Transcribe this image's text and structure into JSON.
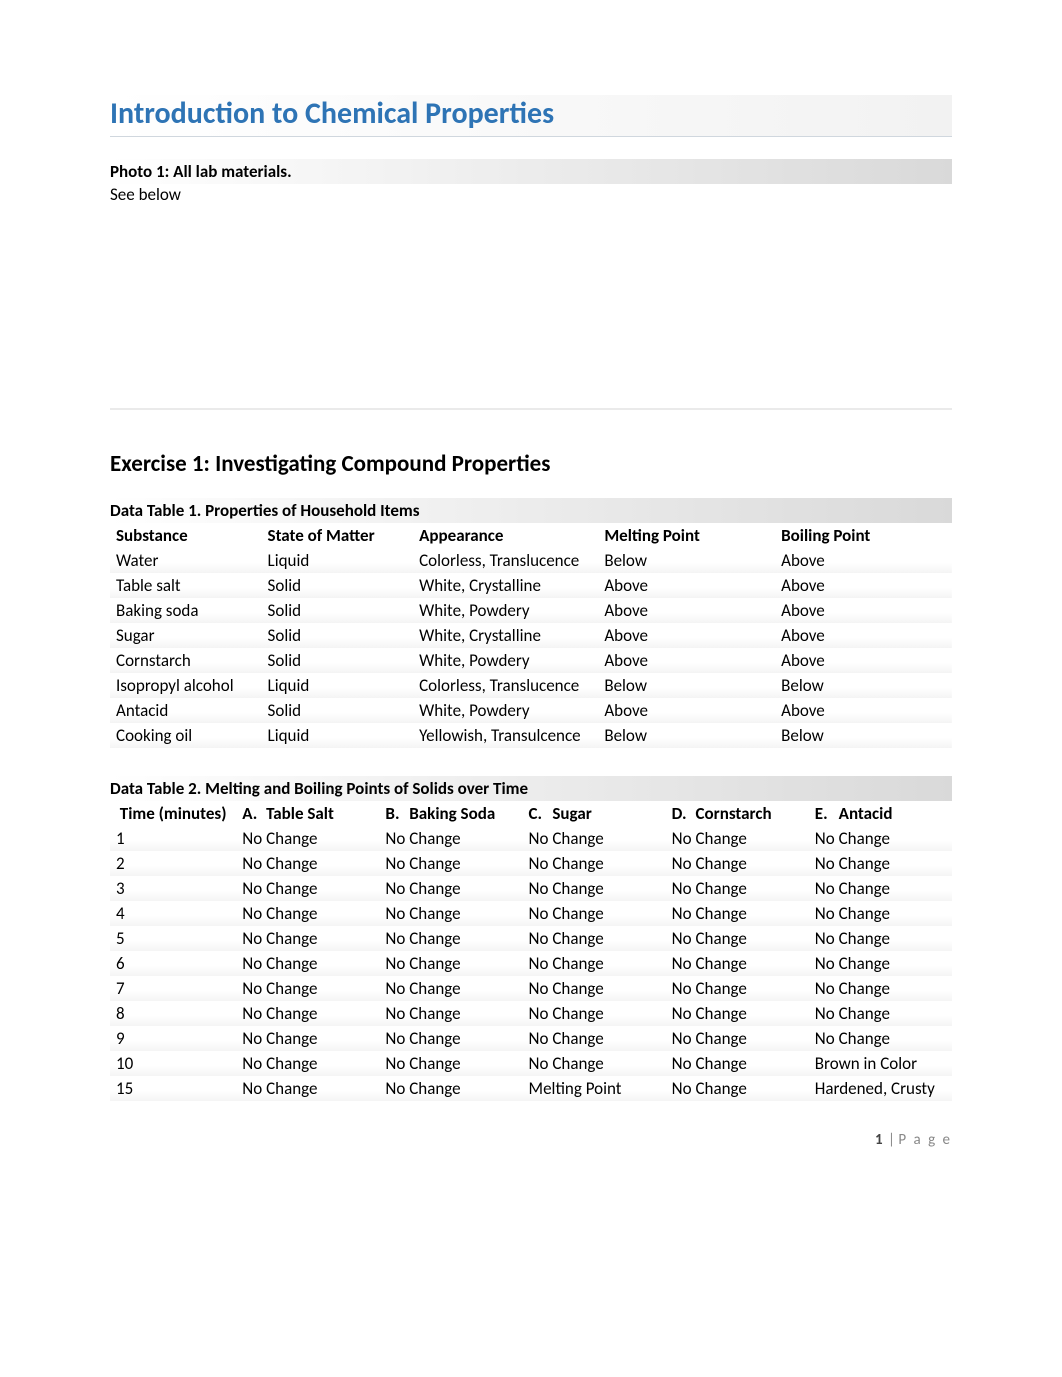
{
  "title": "Introduction to Chemical Properties",
  "photo": {
    "caption": "Photo 1: All lab materials.",
    "note": "See below"
  },
  "exercise1": {
    "title": "Exercise 1: Investigating Compound Properties",
    "table1": {
      "title": "Data Table 1. Properties of Household Items",
      "headers": [
        "Substance",
        "State of Matter",
        "Appearance",
        "Melting Point",
        "Boiling Point"
      ],
      "rows": [
        [
          "Water",
          "Liquid",
          "Colorless, Translucence",
          "Below",
          "Above"
        ],
        [
          "Table salt",
          "Solid",
          "White, Crystalline",
          "Above",
          "Above"
        ],
        [
          "Baking soda",
          "Solid",
          "White, Powdery",
          "Above",
          "Above"
        ],
        [
          "Sugar",
          "Solid",
          "White, Crystalline",
          "Above",
          "Above"
        ],
        [
          "Cornstarch",
          "Solid",
          "White, Powdery",
          "Above",
          "Above"
        ],
        [
          "Isopropyl alcohol",
          "Liquid",
          "Colorless, Translucence",
          "Below",
          "Below"
        ],
        [
          "Antacid",
          "Solid",
          "White, Powdery",
          "Above",
          "Above"
        ],
        [
          "Cooking oil",
          "Liquid",
          "Yellowish, Transulcence",
          "Below",
          "Below"
        ]
      ]
    },
    "table2": {
      "title": "Data Table 2. Melting and Boiling Points of Solids over Time",
      "headers": {
        "time": "Time (minutes)",
        "cols": [
          {
            "prefix": "A.",
            "label": "Table Salt"
          },
          {
            "prefix": "B.",
            "label": "Baking Soda"
          },
          {
            "prefix": "C.",
            "label": "Sugar"
          },
          {
            "prefix": "D.",
            "label": "Cornstarch"
          },
          {
            "prefix": "E.",
            "label": "Antacid"
          }
        ]
      },
      "rows": [
        [
          "1",
          "No Change",
          "No Change",
          "No Change",
          "No Change",
          "No Change"
        ],
        [
          "2",
          "No Change",
          "No Change",
          "No Change",
          "No Change",
          "No Change"
        ],
        [
          "3",
          "No Change",
          "No Change",
          "No Change",
          "No Change",
          "No Change"
        ],
        [
          "4",
          "No Change",
          "No Change",
          "No Change",
          "No Change",
          "No Change"
        ],
        [
          "5",
          "No Change",
          "No Change",
          "No Change",
          "No Change",
          "No Change"
        ],
        [
          "6",
          "No Change",
          "No Change",
          "No Change",
          "No Change",
          "No Change"
        ],
        [
          "7",
          "No Change",
          "No Change",
          "No Change",
          "No Change",
          "No Change"
        ],
        [
          "8",
          "No Change",
          "No Change",
          "No Change",
          "No Change",
          "No Change"
        ],
        [
          "9",
          "No Change",
          "No Change",
          "No Change",
          "No Change",
          "No Change"
        ],
        [
          "10",
          "No Change",
          "No Change",
          "No Change",
          "No Change",
          "Brown in Color"
        ],
        [
          "15",
          "No Change",
          "No Change",
          "Melting Point",
          "No Change",
          "Hardened, Crusty"
        ]
      ]
    }
  },
  "footer": {
    "pageNum": "1",
    "pageLabel": "P a g e"
  }
}
